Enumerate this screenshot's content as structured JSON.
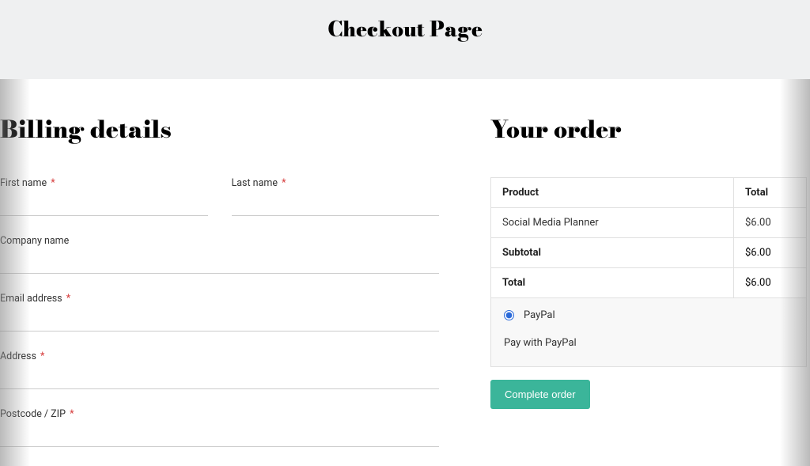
{
  "header": {
    "title": "Checkout Page"
  },
  "billing": {
    "heading": "Billing details",
    "fields": {
      "first_name": {
        "label": "First name",
        "required": true,
        "value": ""
      },
      "last_name": {
        "label": "Last name",
        "required": true,
        "value": ""
      },
      "company": {
        "label": "Company name",
        "required": false,
        "value": ""
      },
      "email": {
        "label": "Email address",
        "required": true,
        "value": ""
      },
      "address": {
        "label": "Address",
        "required": true,
        "value": ""
      },
      "postcode": {
        "label": "Postcode / ZIP",
        "required": true,
        "value": ""
      }
    }
  },
  "order": {
    "heading": "Your order",
    "columns": {
      "product": "Product",
      "total": "Total"
    },
    "items": [
      {
        "name": "Social Media Planner",
        "price": "$6.00"
      }
    ],
    "subtotal": {
      "label": "Subtotal",
      "value": "$6.00"
    },
    "total": {
      "label": "Total",
      "value": "$6.00"
    },
    "payment": {
      "option_label": "PayPal",
      "selected": true,
      "description": "Pay with PayPal"
    },
    "button": "Complete order"
  },
  "required_marker": "*"
}
